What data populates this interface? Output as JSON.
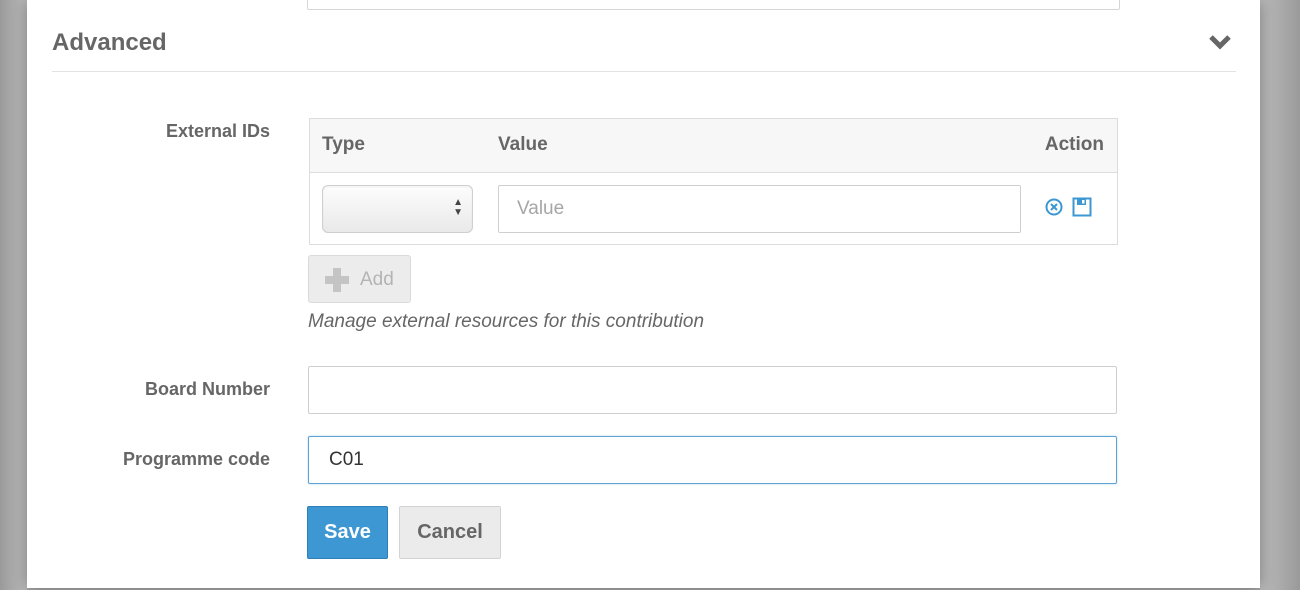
{
  "section": {
    "title": "Advanced"
  },
  "external_ids": {
    "label": "External IDs",
    "columns": [
      "Type",
      "Value",
      "Action"
    ],
    "row": {
      "type_value": "",
      "value_placeholder": "Value"
    },
    "add_label": "Add",
    "help": "Manage external resources for this contribution"
  },
  "board_number": {
    "label": "Board Number",
    "value": ""
  },
  "programme_code": {
    "label": "Programme code",
    "value": "C01"
  },
  "buttons": {
    "save": "Save",
    "cancel": "Cancel"
  },
  "colors": {
    "primary": "#3d97d2",
    "action_icon": "#3d97d2",
    "focus_border": "#5ca2d3"
  },
  "icons": {
    "collapse": "chevron-down-icon",
    "row_remove": "remove-circle-icon",
    "row_save": "floppy-disk-icon",
    "add": "plus-icon"
  }
}
